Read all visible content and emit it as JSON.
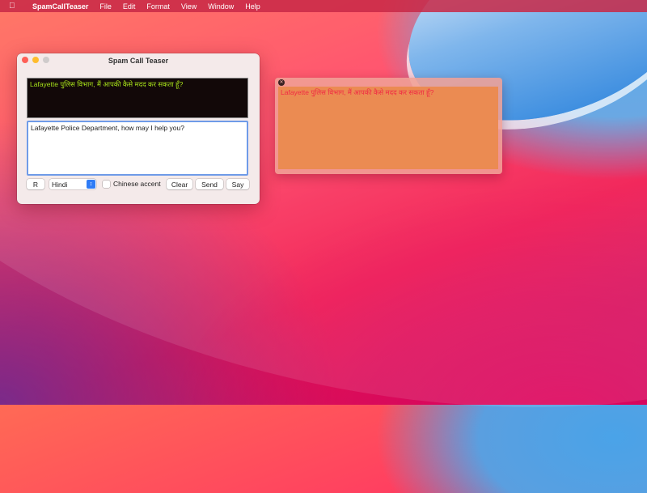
{
  "menubar": {
    "app_name": "SpamCallTeaser",
    "items": [
      "File",
      "Edit",
      "Format",
      "View",
      "Window",
      "Help"
    ]
  },
  "window": {
    "title": "Spam Call Teaser",
    "output_text": "Lafayette पुलिस विभाग, मैं आपकी कैसे मदद कर सकता हूँ?",
    "input_text": "Lafayette Police Department, how may I help you?",
    "controls": {
      "r_label": "R",
      "language": "Hindi",
      "accent_label": "Chinese accent",
      "accent_checked": false,
      "clear_label": "Clear",
      "send_label": "Send",
      "say_label": "Say"
    }
  },
  "panel": {
    "text": "Lafayette पुलिस विभाग, मैं आपकी कैसे मदद कर सकता हूँ?"
  },
  "icons": {
    "apple": "apple-icon",
    "chevron": "chevron-updown-icon",
    "close": "close-icon"
  },
  "colors": {
    "output_text": "#a6e01a",
    "panel_text": "#f02a44",
    "accent": "#2f7cf6"
  }
}
